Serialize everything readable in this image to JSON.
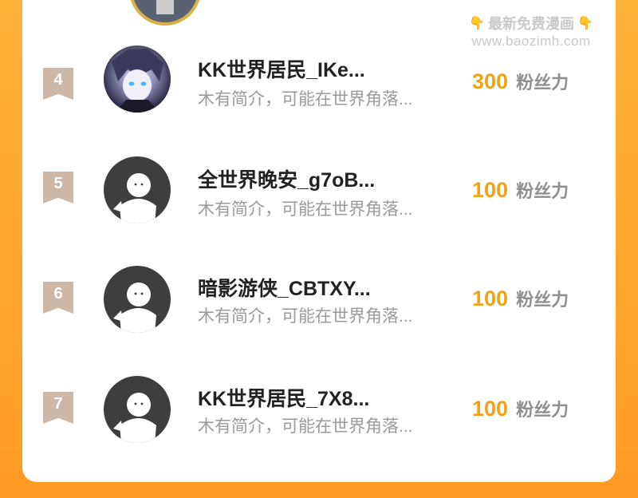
{
  "watermark": {
    "line1": "最新免费漫画",
    "line2": "www.baozimh.com",
    "icon": "pointing-down-icon"
  },
  "ranking": [
    {
      "rank": "4",
      "name": "KK世界居民_IKe...",
      "bio": "木有简介，可能在世界角落...",
      "fans": "300",
      "unit": "粉丝力",
      "avatar": "anime-avatar"
    },
    {
      "rank": "5",
      "name": "全世界晚安_g7oB...",
      "bio": "木有简介，可能在世界角落...",
      "fans": "100",
      "unit": "粉丝力",
      "avatar": "default-avatar"
    },
    {
      "rank": "6",
      "name": "暗影游侠_CBTXY...",
      "bio": "木有简介，可能在世界角落...",
      "fans": "100",
      "unit": "粉丝力",
      "avatar": "default-avatar"
    },
    {
      "rank": "7",
      "name": "KK世界居民_7X8...",
      "bio": "木有简介，可能在世界角落...",
      "fans": "100",
      "unit": "粉丝力",
      "avatar": "default-avatar"
    }
  ],
  "colors": {
    "background": "#ffa52b",
    "fans_number": "#f0a21a",
    "rank_badge": "#cdb7a6"
  }
}
